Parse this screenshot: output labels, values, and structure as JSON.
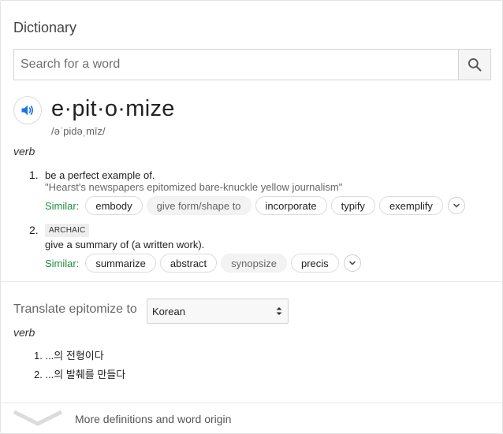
{
  "title": "Dictionary",
  "search": {
    "placeholder": "Search for a word",
    "value": ""
  },
  "entry": {
    "headword": "e·pit·o·mize",
    "phonetic": "/əˈpidəˌmīz/",
    "part_of_speech": "verb",
    "senses": [
      {
        "number": "1.",
        "definition": "be a perfect example of.",
        "example": "\"Hearst's newspapers epitomized bare-knuckle yellow journalism\"",
        "similar_label": "Similar:",
        "similar": [
          "embody",
          "give form/shape to",
          "incorporate",
          "typify",
          "exemplify"
        ]
      },
      {
        "number": "2.",
        "tag": "ARCHAIC",
        "definition": "give a summary of (a written work).",
        "similar_label": "Similar:",
        "similar": [
          "summarize",
          "abstract",
          "synopsize",
          "precis"
        ]
      }
    ]
  },
  "translate": {
    "label": "Translate epitomize to",
    "selected_language": "Korean",
    "part_of_speech": "verb",
    "items": [
      "1. ...의 전형이다",
      "2. ...의 발췌를 만들다"
    ]
  },
  "more": {
    "label": "More definitions and word origin"
  },
  "icons": {
    "search": "search-icon",
    "speaker": "speaker-icon",
    "expand": "chevron-down-icon",
    "select": "updown-arrows-icon"
  },
  "colors": {
    "accent_blue": "#1a73e8",
    "similar_green": "#1e8e3e"
  }
}
